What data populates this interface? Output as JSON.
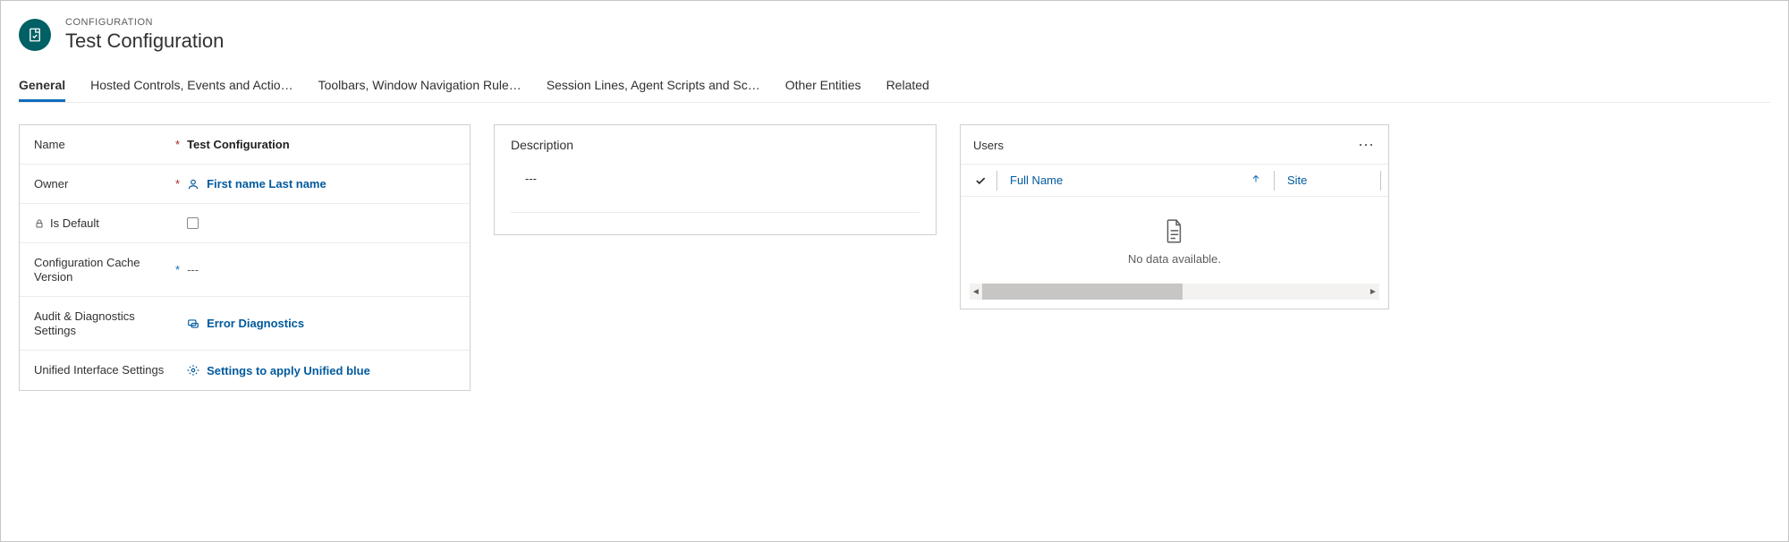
{
  "header": {
    "overline": "CONFIGURATION",
    "title": "Test Configuration"
  },
  "tabs": [
    {
      "label": "General",
      "active": true
    },
    {
      "label": "Hosted Controls, Events and Actio…",
      "active": false
    },
    {
      "label": "Toolbars, Window Navigation Rule…",
      "active": false
    },
    {
      "label": "Session Lines, Agent Scripts and Sc…",
      "active": false
    },
    {
      "label": "Other Entities",
      "active": false
    },
    {
      "label": "Related",
      "active": false
    }
  ],
  "fields": {
    "name": {
      "label": "Name",
      "required": "*",
      "value": "Test Configuration"
    },
    "owner": {
      "label": "Owner",
      "required": "*",
      "value": "First name Last name"
    },
    "isDefault": {
      "label": "Is Default"
    },
    "cacheVersion": {
      "label": "Configuration Cache Version",
      "required": "*",
      "value": "---"
    },
    "audit": {
      "label": "Audit & Diagnostics Settings",
      "value": "Error Diagnostics"
    },
    "unified": {
      "label": "Unified Interface Settings",
      "value": "Settings to apply Unified blue"
    }
  },
  "description": {
    "label": "Description",
    "value": "---"
  },
  "users": {
    "title": "Users",
    "cols": {
      "fullName": "Full Name",
      "site": "Site"
    },
    "empty": "No data available."
  }
}
